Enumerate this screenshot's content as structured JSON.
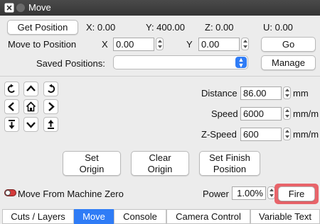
{
  "window": {
    "title": "Move"
  },
  "position": {
    "get_position_label": "Get Position",
    "x_readout": "X: 0.00",
    "y_readout": "Y: 400.00",
    "z_readout": "Z: 0.00",
    "u_readout": "U: 0.00"
  },
  "move_to": {
    "label": "Move to Position",
    "x_label": "X",
    "x_value": "0.00",
    "y_label": "Y",
    "y_value": "0.00",
    "go_label": "Go"
  },
  "saved": {
    "label": "Saved Positions:",
    "selected": "",
    "manage_label": "Manage"
  },
  "jog": {
    "icons": [
      "rotate-ccw-icon",
      "arrow-up-icon",
      "rotate-cw-icon",
      "arrow-left-icon",
      "home-icon",
      "arrow-right-icon",
      "z-down-icon",
      "arrow-down-icon",
      "z-up-icon"
    ]
  },
  "params": {
    "distance_label": "Distance",
    "distance_value": "86.00",
    "distance_unit": "mm",
    "speed_label": "Speed",
    "speed_value": "6000",
    "speed_unit": "mm/m",
    "zspeed_label": "Z-Speed",
    "zspeed_value": "600",
    "zspeed_unit": "mm/m"
  },
  "actions": {
    "set_origin_line1": "Set",
    "set_origin_line2": "Origin",
    "clear_origin_line1": "Clear",
    "clear_origin_line2": "Origin",
    "set_finish_line1": "Set Finish",
    "set_finish_line2": "Position"
  },
  "bottom": {
    "machine_zero_label": "Move From Machine Zero",
    "power_label": "Power",
    "power_value": "1.00%",
    "fire_label": "Fire"
  },
  "tabs": [
    "Cuts / Layers",
    "Move",
    "Console",
    "Camera Control",
    "Variable Text"
  ],
  "colors": {
    "accent": "#2f7cf6",
    "fire_highlight": "#e8646a",
    "toggle_red": "#d43b3b"
  }
}
